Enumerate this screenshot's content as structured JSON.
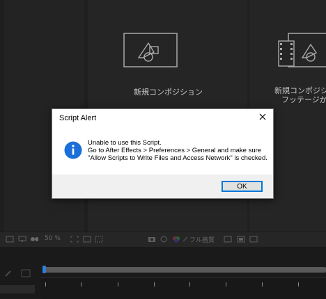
{
  "cards": [
    {
      "label": "新規コンポジション",
      "icon": "composition-icon"
    },
    {
      "label_line1": "新規コンポジシ",
      "label_line2": "フッテージか",
      "icon": "footage-composition-icon"
    }
  ],
  "viewer_toolbar": {
    "zoom": "50 %",
    "resolution": "フル画質"
  },
  "dialog": {
    "title": "Script Alert",
    "icon": "info-icon",
    "message_line1": "Unable to use this Script.",
    "message_line2": "Go to After Effects > Preferences > General and make sure",
    "message_line3": "\"Allow Scripts to Write Files and Access Network\" is checked.",
    "ok_label": "OK"
  },
  "colors": {
    "accent": "#0078d7",
    "info_icon": "#1a6fd8",
    "playhead": "#2f7fe0"
  }
}
